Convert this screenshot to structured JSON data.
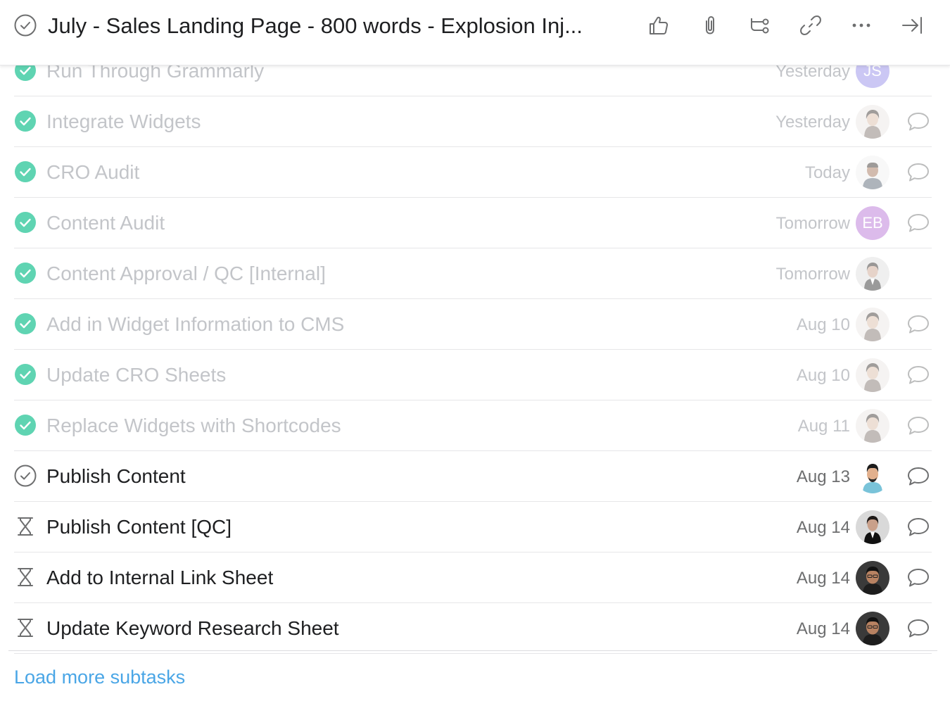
{
  "header": {
    "title": "July - Sales Landing Page - 800 words - Explosion Inj...",
    "icons": [
      "check-circle-icon",
      "thumbs-up-icon",
      "paperclip-icon",
      "subtasks-icon",
      "link-icon",
      "more-icon",
      "close-panel-icon"
    ]
  },
  "colors": {
    "done_green": "#5fd4b2",
    "faded_text": "#c3c5c9",
    "link_blue": "#4aa6e6",
    "avatar_js": "#8d84e8",
    "avatar_eb": "#b36bd4"
  },
  "subtasks": [
    {
      "name": "Run Through Grammarly",
      "date": "Yesterday",
      "status": "done",
      "avatar": "JS",
      "comment": false
    },
    {
      "name": "Integrate Widgets",
      "date": "Yesterday",
      "status": "done",
      "avatar": "photo",
      "comment": true
    },
    {
      "name": "CRO Audit",
      "date": "Today",
      "status": "done",
      "avatar": "photo",
      "comment": true
    },
    {
      "name": "Content Audit",
      "date": "Tomorrow",
      "status": "done",
      "avatar": "EB",
      "comment": true
    },
    {
      "name": "Content Approval / QC [Internal]",
      "date": "Tomorrow",
      "status": "done",
      "avatar": "photo",
      "comment": false
    },
    {
      "name": "Add in Widget Information to CMS",
      "date": "Aug 10",
      "status": "done",
      "avatar": "photo",
      "comment": true
    },
    {
      "name": "Update CRO Sheets",
      "date": "Aug 10",
      "status": "done",
      "avatar": "photo",
      "comment": true
    },
    {
      "name": "Replace Widgets with Shortcodes",
      "date": "Aug 11",
      "status": "done",
      "avatar": "photo",
      "comment": true
    },
    {
      "name": "Publish Content",
      "date": "Aug 13",
      "status": "open",
      "avatar": "photo",
      "comment": true
    },
    {
      "name": "Publish Content [QC]",
      "date": "Aug 14",
      "status": "waiting",
      "avatar": "photo",
      "comment": true
    },
    {
      "name": "Add to Internal Link Sheet",
      "date": "Aug 14",
      "status": "waiting",
      "avatar": "photo",
      "comment": true
    },
    {
      "name": "Update Keyword Research Sheet",
      "date": "Aug 14",
      "status": "waiting",
      "avatar": "photo",
      "comment": true
    }
  ],
  "footer": {
    "load_more": "Load more subtasks"
  }
}
